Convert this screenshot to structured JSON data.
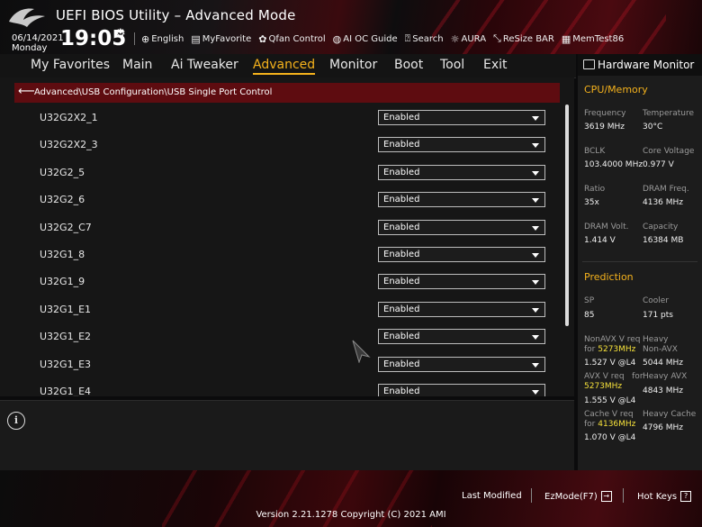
{
  "header": {
    "title": "UEFI BIOS Utility – Advanced Mode",
    "date": "06/14/2021",
    "day": "Monday",
    "time": "19:05",
    "tools": [
      {
        "icon": "globe-icon",
        "glyph": "⊕",
        "label": "English"
      },
      {
        "icon": "favorite-icon",
        "glyph": "▤",
        "label": "MyFavorite"
      },
      {
        "icon": "fan-icon",
        "glyph": "✿",
        "label": "Qfan Control"
      },
      {
        "icon": "ai-oc-icon",
        "glyph": "◍",
        "label": "AI OC Guide"
      },
      {
        "icon": "search-icon",
        "glyph": "⍰",
        "label": "Search"
      },
      {
        "icon": "aura-icon",
        "glyph": "☼",
        "label": "AURA"
      },
      {
        "icon": "resize-bar-icon",
        "glyph": "⤡",
        "label": "ReSize BAR"
      },
      {
        "icon": "memtest-icon",
        "glyph": "▦",
        "label": "MemTest86"
      }
    ]
  },
  "menu": {
    "tabs": [
      "My Favorites",
      "Main",
      "Ai Tweaker",
      "Advanced",
      "Monitor",
      "Boot",
      "Tool",
      "Exit"
    ],
    "active": "Advanced"
  },
  "breadcrumb": "Advanced\\USB Configuration\\USB Single Port Control",
  "settings": [
    {
      "label": "U32G2X2_1",
      "value": "Enabled"
    },
    {
      "label": "U32G2X2_3",
      "value": "Enabled"
    },
    {
      "label": "U32G2_5",
      "value": "Enabled"
    },
    {
      "label": "U32G2_6",
      "value": "Enabled"
    },
    {
      "label": "U32G2_C7",
      "value": "Enabled"
    },
    {
      "label": "U32G1_8",
      "value": "Enabled"
    },
    {
      "label": "U32G1_9",
      "value": "Enabled"
    },
    {
      "label": "U32G1_E1",
      "value": "Enabled"
    },
    {
      "label": "U32G1_E2",
      "value": "Enabled"
    },
    {
      "label": "U32G1_E3",
      "value": "Enabled"
    },
    {
      "label": "U32G1_E4",
      "value": "Enabled"
    }
  ],
  "hardware_monitor": {
    "title": "Hardware Monitor",
    "cpu_memory": {
      "title": "CPU/Memory",
      "items": [
        {
          "label": "Frequency",
          "value": "3619 MHz"
        },
        {
          "label": "Temperature",
          "value": "30°C"
        },
        {
          "label": "BCLK",
          "value": "103.4000 MHz"
        },
        {
          "label": "Core Voltage",
          "value": "0.977 V"
        },
        {
          "label": "Ratio",
          "value": "35x"
        },
        {
          "label": "DRAM Freq.",
          "value": "4136 MHz"
        },
        {
          "label": "DRAM Volt.",
          "value": "1.414 V"
        },
        {
          "label": "Capacity",
          "value": "16384 MB"
        }
      ]
    },
    "prediction": {
      "title": "Prediction",
      "sp_label": "SP",
      "sp_value": "85",
      "cooler_label": "Cooler",
      "cooler_value": "171 pts",
      "nonavx_label": "NonAVX V req",
      "for": "for",
      "nonavx_freq": "5273MHz",
      "nonavx_value": "1.527 V @L4",
      "heavy_nonavx_label1": "Heavy",
      "heavy_nonavx_label2": "Non-AVX",
      "heavy_nonavx_value": "5044 MHz",
      "avx_label": "AVX V req",
      "avx_freq": "5273MHz",
      "avx_value": "1.555 V @L4",
      "heavy_avx_label": "Heavy AVX",
      "heavy_avx_value": "4843 MHz",
      "cache_label": "Cache V req",
      "cache_freq": "4136MHz",
      "cache_value": "1.070 V @L4",
      "heavy_cache_label": "Heavy Cache",
      "heavy_cache_value": "4796 MHz"
    }
  },
  "footer": {
    "last_modified": "Last Modified",
    "ezmode": "EzMode(F7)",
    "hotkeys": "Hot Keys",
    "version": "Version 2.21.1278 Copyright (C) 2021 AMI"
  }
}
